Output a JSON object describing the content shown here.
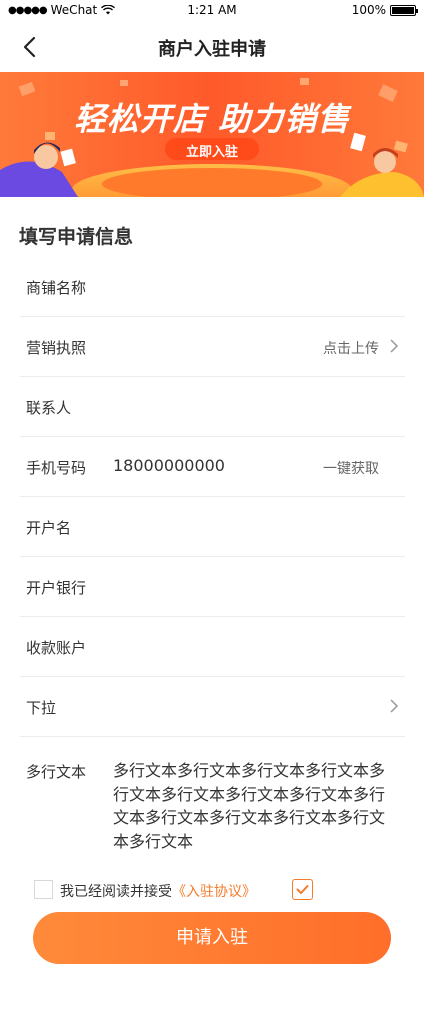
{
  "status_bar": {
    "carrier": "WeChat",
    "time": "1:21 AM",
    "battery": "100%"
  },
  "nav": {
    "title": "商户入驻申请"
  },
  "banner": {
    "headline": "轻松开店 助力销售",
    "cta": "立即入驻"
  },
  "form": {
    "title": "填写申请信息",
    "rows": [
      {
        "label": "商铺名称",
        "value": "",
        "action": ""
      },
      {
        "label": "营销执照",
        "value": "",
        "action": "点击上传"
      },
      {
        "label": "联系人",
        "value": "",
        "action": ""
      },
      {
        "label": "手机号码",
        "value": "18000000000",
        "action": "一键获取"
      },
      {
        "label": "开户名",
        "value": "",
        "action": ""
      },
      {
        "label": "开户银行",
        "value": "",
        "action": ""
      },
      {
        "label": "收款账户",
        "value": "",
        "action": ""
      },
      {
        "label": "下拉",
        "value": "",
        "action": ""
      }
    ],
    "multiline": {
      "label": "多行文本",
      "value": "多行文本多行文本多行文本多行文本多行文本多行文本多行文本多行文本多行文本多行文本多行文本多行文本多行文本多行文本"
    }
  },
  "agreement": {
    "text": "我已经阅读并接受",
    "link": "《入驻协议》",
    "checked": true
  },
  "submit": {
    "label": "申请入驻"
  },
  "colors": {
    "accent": "#f47b2a",
    "button": "#ff7a32"
  }
}
